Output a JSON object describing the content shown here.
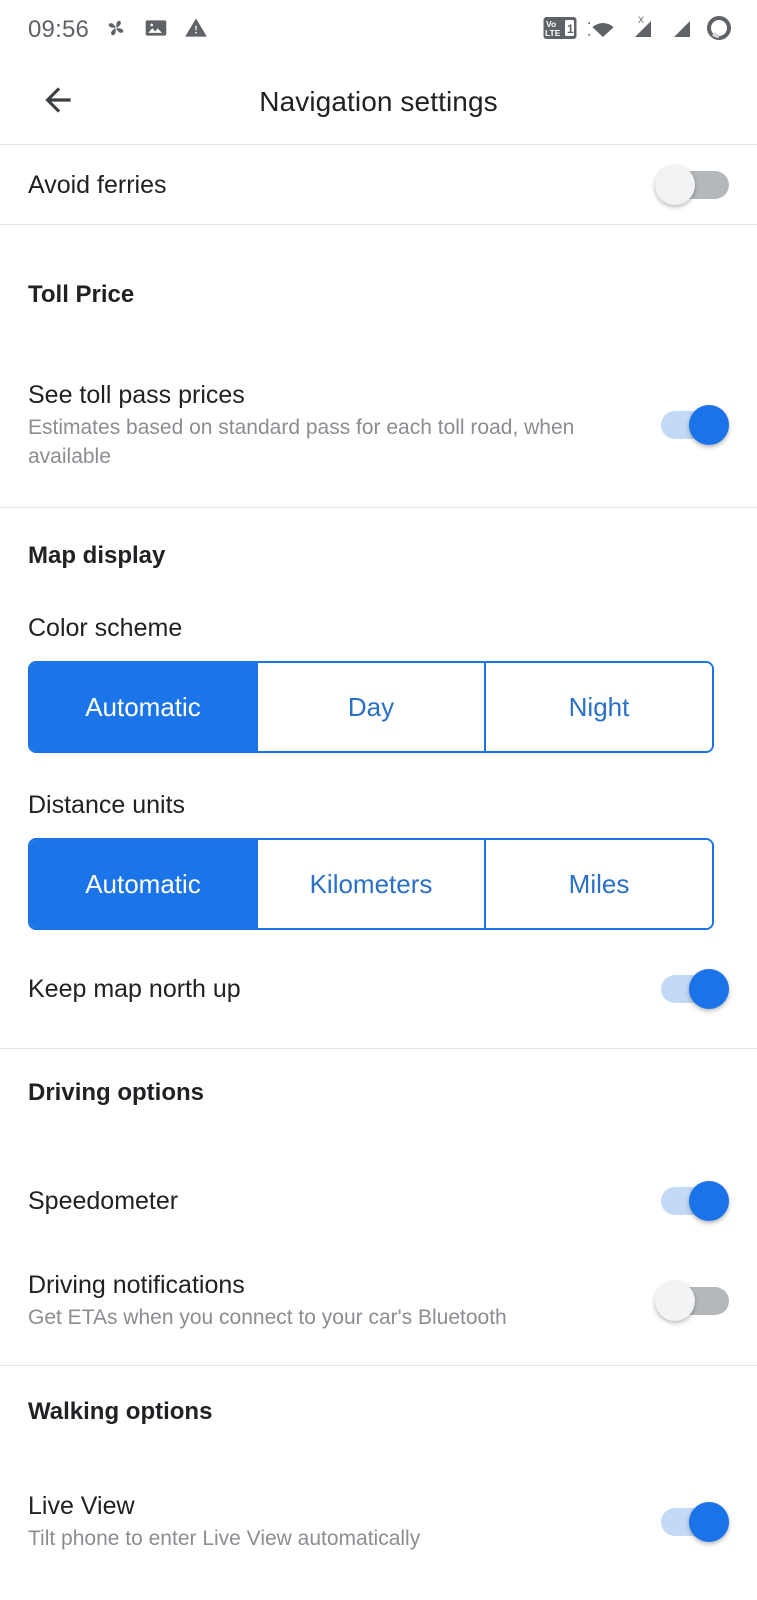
{
  "status_bar": {
    "clock": "09:56",
    "left_icons": [
      "pinwheel-icon",
      "photo-icon",
      "warning-triangle-icon"
    ],
    "right_icons": [
      "volte-1-icon",
      "wifi-icon",
      "signal-no-service-icon",
      "signal-bars-icon",
      "battery-circle-icon"
    ],
    "volte_label_top": "Vo",
    "volte_label_bottom": "LTE",
    "volte_sim": "1",
    "no_service_mark": "X"
  },
  "app_bar": {
    "back_icon": "back-arrow-icon",
    "title": "Navigation settings"
  },
  "rows": {
    "avoid_ferries": {
      "title": "Avoid ferries",
      "state": "off"
    },
    "see_toll_pass_prices": {
      "title": "See toll pass prices",
      "subtitle": "Estimates based on standard pass for each toll road, when available",
      "state": "on"
    },
    "keep_map_north_up": {
      "title": "Keep map north up",
      "state": "on"
    },
    "speedometer": {
      "title": "Speedometer",
      "state": "on"
    },
    "driving_notifications": {
      "title": "Driving notifications",
      "subtitle": "Get ETAs when you connect to your car's Bluetooth",
      "state": "off"
    },
    "live_view": {
      "title": "Live View",
      "subtitle": "Tilt phone to enter Live View automatically",
      "state": "on"
    }
  },
  "sections": {
    "toll_price": {
      "title": "Toll Price"
    },
    "map_display": {
      "title": "Map display"
    },
    "driving_options": {
      "title": "Driving options"
    },
    "walking_options": {
      "title": "Walking options"
    }
  },
  "color_scheme": {
    "label": "Color scheme",
    "options": [
      "Automatic",
      "Day",
      "Night"
    ],
    "selected": "Automatic"
  },
  "distance_units": {
    "label": "Distance units",
    "options": [
      "Automatic",
      "Kilometers",
      "Miles"
    ],
    "selected": "Automatic"
  },
  "colors": {
    "accent_blue": "#1a73e8",
    "track_on": "#c3d9f8",
    "track_off": "#b5b8bb",
    "thumb_off": "#f1f3f4",
    "primary_text": "#202124",
    "secondary_text": "#8a8d91",
    "divider": "#e4e6e8"
  }
}
